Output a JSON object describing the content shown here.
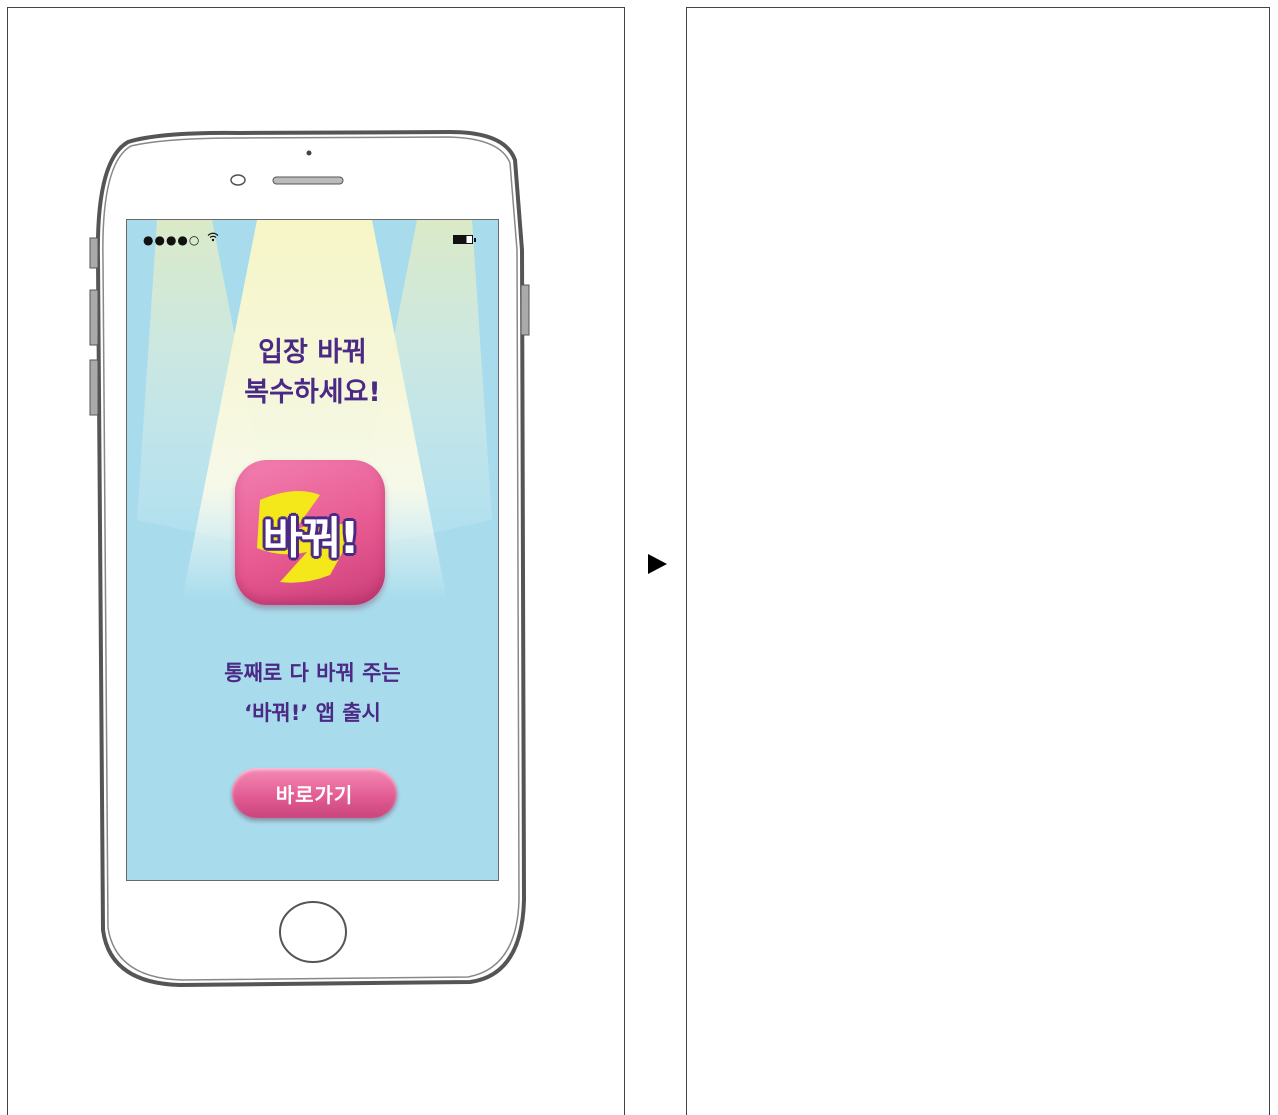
{
  "status_bar": {
    "signal": "●●●●○",
    "wifi_icon": "wifi-icon",
    "battery_icon": "battery-icon"
  },
  "screen": {
    "headline_line1": "입장 바꿔",
    "headline_line2": "복수하세요!",
    "app_icon_label": "바꿔!",
    "description_line1": "통째로 다 바꿔 주는",
    "description_line2": "‘바꿔!’ 앱 출시",
    "go_button_label": "바로가기"
  },
  "colors": {
    "screen_background": "#a8dcec",
    "text_purple": "#4b2a86",
    "icon_pink": "#e6578f",
    "splash_yellow": "#f5e81a"
  },
  "navigation": {
    "next_arrow_icon": "play-arrow-icon"
  }
}
